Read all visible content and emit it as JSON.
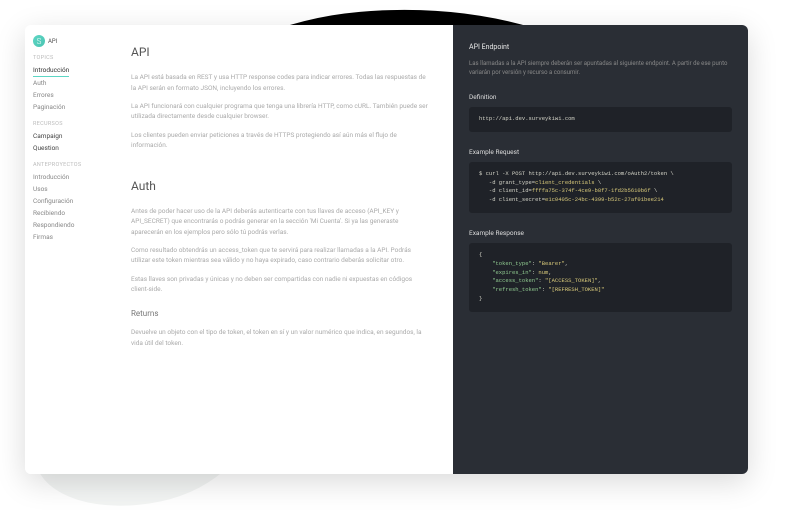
{
  "logo": {
    "icon_letter": "S",
    "text": "API"
  },
  "sidebar": {
    "sections": [
      {
        "label": "TOPICS",
        "items": [
          {
            "label": "Introducción",
            "active": true
          },
          {
            "label": "Auth"
          },
          {
            "label": "Errores"
          },
          {
            "label": "Paginación"
          }
        ]
      },
      {
        "label": "RECURSOS",
        "items": [
          {
            "label": "Campaign",
            "dark": true
          },
          {
            "label": "Question",
            "dark": true
          }
        ]
      },
      {
        "label": "ANTEPROYECTOS",
        "items": [
          {
            "label": "Introducción"
          },
          {
            "label": "Usos"
          },
          {
            "label": "Configuración"
          },
          {
            "label": "Recibiendo"
          },
          {
            "label": "Respondiendo"
          },
          {
            "label": "Firmas"
          }
        ]
      }
    ]
  },
  "content": {
    "api": {
      "title": "API",
      "p1": "La API está basada en REST y usa HTTP response codes para indicar errores. Todas las respuestas de la API serán en formato JSON, incluyendo los errores.",
      "p2": "La API funcionará con cualquier programa que tenga una librería HTTP, como cURL. También puede ser utilizada directamente desde cualquier browser.",
      "p3": "Los clientes pueden enviar peticiones a través de HTTPS protegiendo así aún más el flujo de información."
    },
    "auth": {
      "title": "Auth",
      "p1": "Antes de poder hacer uso de la API deberás autenticarte con tus llaves de acceso (API_KEY y API_SECRET) que encontrarás o podrás generar en la sección 'Mi Cuenta'. Si ya las generaste aparecerán en los ejemplos pero sólo tú podrás verlas.",
      "p2": "Como resultado obtendrás un access_token que te servirá para realizar llamadas a la API. Podrás utilizar este token mientras sea válido y no haya expirado, caso contrario deberás solicitar otro.",
      "p3": "Estas llaves son privadas y únicas y no deben ser compartidas con nadie ni expuestas en códigos client-side.",
      "returns_title": "Returns",
      "returns_p": "Devuelve un objeto con el tipo de token, el token en sí y un valor numérico que indica, en segundos, la vida útil del token."
    }
  },
  "darkpanel": {
    "endpoint": {
      "title": "API Endpoint",
      "desc": "Las llamadas a la API siempre deberán ser apuntadas al siguiente endpoint. A partir de ese punto variarán por versión y recurso a consumir.",
      "def_label": "Definition",
      "def_code": "http://api.dev.surveykiwi.com"
    },
    "example_req": {
      "label": "Example Request",
      "line1": "$ curl -X POST http://api.dev.surveykiwi.com/oAuth2/token \\",
      "line2": "   -d grant_type=",
      "line2_val": "client_credentials",
      "line3": "   -d client_id=",
      "line3_val": "ffffa75c-374f-4ce9-b8f7-1fd2b5610b6f",
      "line4": "   -d client_secret=",
      "line4_val": "e1c0405c-24bc-4399-b52c-27af01bee214"
    },
    "example_res": {
      "label": "Example Response",
      "open": "{",
      "k1": "\"token_type\"",
      "v1": "\"Bearer\"",
      "k2": "\"expires_in\"",
      "v2": "num",
      "k3": "\"access_token\"",
      "v3": "\"[ACCESS_TOKEN]\"",
      "k4": "\"refresh_token\"",
      "v4": "\"[REFRESH_TOKEN]\"",
      "close": "}"
    }
  }
}
